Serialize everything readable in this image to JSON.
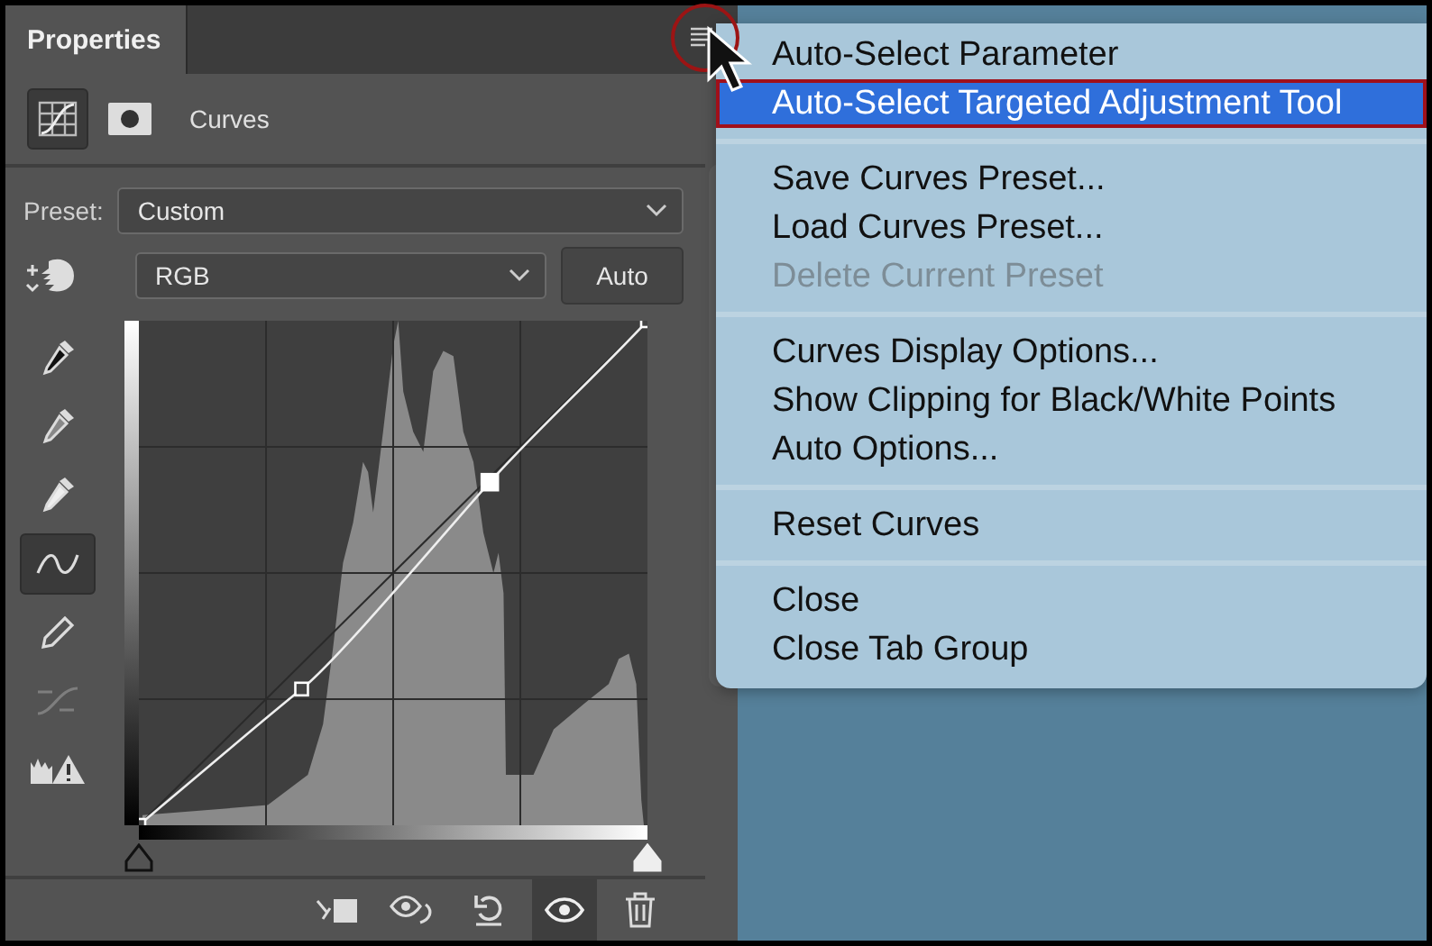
{
  "panel": {
    "tab": "Properties",
    "header_buttons": [
      {
        "kind": "curves",
        "selected": true
      },
      {
        "kind": "mask",
        "selected": false
      }
    ],
    "adjustment": "Curves",
    "menu_button": {
      "highlighted": true
    }
  },
  "preset": {
    "label": "Preset:",
    "value": "Custom"
  },
  "channel": {
    "value": "RGB"
  },
  "auto_button": "Auto",
  "input_sliders": [
    {
      "kind": "shadow",
      "level": 0
    },
    {
      "kind": "highlight",
      "level": 1
    }
  ],
  "tools": [
    {
      "kind": "black-dropper",
      "selected": false,
      "disabled": false
    },
    {
      "kind": "gray-dropper",
      "selected": false,
      "disabled": false
    },
    {
      "kind": "white-dropper",
      "selected": false,
      "disabled": false
    },
    {
      "kind": "curve",
      "selected": true,
      "disabled": false
    },
    {
      "kind": "pencil",
      "selected": false,
      "disabled": false
    },
    {
      "kind": "smooth",
      "selected": false,
      "disabled": true
    },
    {
      "kind": "clipping",
      "selected": false,
      "disabled": false
    }
  ],
  "bottom_buttons": [
    {
      "kind": "clip",
      "selected": false
    },
    {
      "kind": "view-previous",
      "selected": false
    },
    {
      "kind": "reset",
      "selected": false
    },
    {
      "kind": "visibility",
      "selected": true
    },
    {
      "kind": "delete",
      "selected": false
    }
  ],
  "menu": {
    "groups": [
      {
        "items": [
          {
            "label": "Auto-Select Parameter",
            "selected": false,
            "disabled": false
          },
          {
            "label": "Auto-Select Targeted Adjustment Tool",
            "selected": true,
            "disabled": false
          }
        ]
      },
      {
        "items": [
          {
            "label": "Save Curves Preset...",
            "selected": false,
            "disabled": false
          },
          {
            "label": "Load Curves Preset...",
            "selected": false,
            "disabled": false
          },
          {
            "label": "Delete Current Preset",
            "selected": false,
            "disabled": true
          }
        ]
      },
      {
        "items": [
          {
            "label": "Curves Display Options...",
            "selected": false,
            "disabled": false
          },
          {
            "label": "Show Clipping for Black/White Points",
            "selected": false,
            "disabled": false
          },
          {
            "label": "Auto Options...",
            "selected": false,
            "disabled": false
          }
        ]
      },
      {
        "items": [
          {
            "label": "Reset Curves",
            "selected": false,
            "disabled": false
          }
        ]
      },
      {
        "items": [
          {
            "label": "Close",
            "selected": false,
            "disabled": false
          },
          {
            "label": "Close Tab Group",
            "selected": false,
            "disabled": false
          }
        ]
      }
    ]
  }
}
